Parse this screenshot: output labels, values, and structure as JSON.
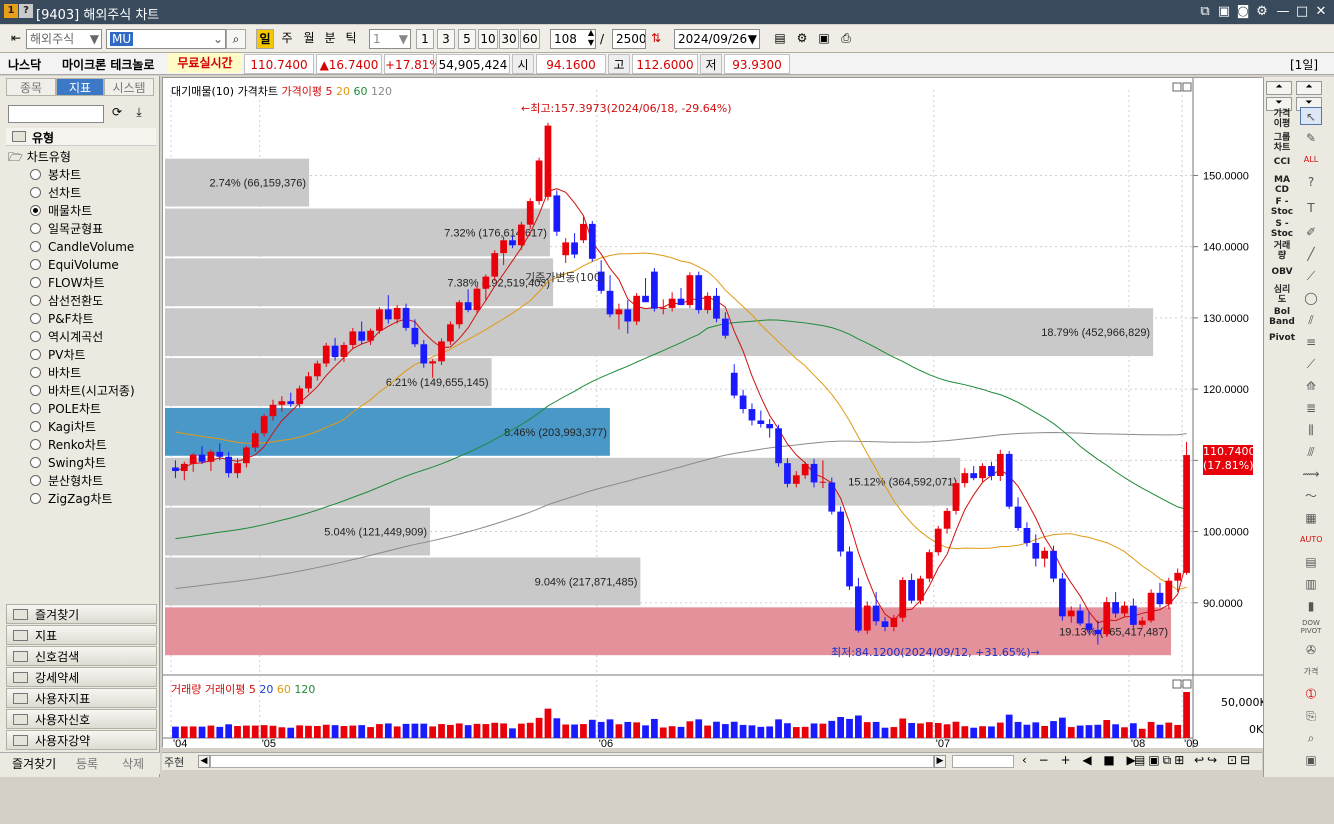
{
  "window": {
    "title": "[9403] 해외주식 차트",
    "icon1": "1",
    "icon2": "?"
  },
  "toolbar": {
    "market_select": "해외주식",
    "symbol": "MU",
    "periods": [
      "일",
      "주",
      "월",
      "분",
      "틱"
    ],
    "interval_value": "1",
    "interval_buttons": [
      "1",
      "3",
      "5",
      "10",
      "30",
      "60"
    ],
    "count_value": "108",
    "total_value": "2500",
    "slash": "/",
    "date": "2024/09/26"
  },
  "quote": {
    "exchange": "나스닥",
    "name": "마이크론 테크놀로",
    "realtime": "무료실시간",
    "price": "110.7400",
    "change": "▲16.7400",
    "change_pct": "+17.81%",
    "volume": "54,905,424",
    "open_label": "시",
    "open": "94.1600",
    "high_label": "고",
    "high": "112.6000",
    "low_label": "저",
    "low": "93.9300",
    "period": "[1일]"
  },
  "left_panel": {
    "tabs": [
      "종목",
      "지표",
      "시스템"
    ],
    "active_tab": "지표",
    "tree_root": "유형",
    "tree_group": "차트유형",
    "chart_types": [
      "봉차트",
      "선차트",
      "매물차트",
      "일목균형표",
      "CandleVolume",
      "EquiVolume",
      "FLOW차트",
      "삼선전환도",
      "P&F차트",
      "역시계곡선",
      "PV차트",
      "바차트",
      "바차트(시고저종)",
      "POLE차트",
      "Kagi차트",
      "Renko차트",
      "Swing차트",
      "분산형차트",
      "ZigZag차트"
    ],
    "selected_type": "매물차트",
    "bottom_buttons": [
      "즐겨찾기",
      "지표",
      "신호검색",
      "강세약세",
      "사용자지표",
      "사용자신호",
      "사용자강약"
    ],
    "footer_tabs": [
      "즐겨찾기",
      "등록",
      "삭제"
    ]
  },
  "chart": {
    "legend_items": [
      "대기매물(10)",
      "가격차트",
      "가격이평",
      "5",
      "20",
      "60",
      "120"
    ],
    "vol_legend_items": [
      "거래량",
      "거래이평",
      "5",
      "20",
      "60",
      "120"
    ],
    "max_label": "←최고:157.3973(2024/06/18, -29.64%)",
    "min_label": "최저:84.1200(2024/09/12, +31.65%)→",
    "base_label": "기준가변동(100)",
    "price_tag": "110.7400",
    "price_pct_tag": "(17.81%)",
    "vol_axis": [
      "50,000K",
      "0K"
    ],
    "bottom_label": "주현"
  },
  "chart_data": {
    "type": "candlestick",
    "y_axis": {
      "ticks": [
        "150.0000",
        "140.0000",
        "130.0000",
        "120.0000",
        "110.0000",
        "100.0000",
        "90.0000"
      ],
      "range": [
        80,
        162
      ]
    },
    "x_axis": {
      "ticks": [
        "'04",
        "'05",
        "'06",
        "'07",
        "'08",
        "'09"
      ]
    },
    "volume_profile": [
      {
        "label": "2.74% (66,159,376)",
        "range": [
          145.5,
          152.5
        ]
      },
      {
        "label": "7.32% (176,614,617)",
        "range": [
          138.5,
          145.5
        ]
      },
      {
        "label": "7.38% (192,519,403)",
        "range": [
          131.5,
          138.5
        ]
      },
      {
        "label": "18.79% (452,966,829)",
        "range": [
          124.5,
          131.5
        ]
      },
      {
        "label": "6.21% (149,655,145)",
        "range": [
          117.5,
          124.5
        ]
      },
      {
        "label": "8.46% (203,993,377)",
        "range": [
          110.5,
          117.5
        ]
      },
      {
        "label": "15.12% (364,592,071)",
        "range": [
          103.5,
          110.5
        ]
      },
      {
        "label": "5.04% (121,449,909)",
        "range": [
          96.5,
          103.5
        ]
      },
      {
        "label": "9.04% (217,871,485)",
        "range": [
          89.5,
          96.5
        ]
      },
      {
        "label": "19.13% (465,417,487)",
        "range": [
          82.5,
          89.5
        ]
      }
    ],
    "profile_pct": [
      2.74,
      7.32,
      7.38,
      18.79,
      6.21,
      8.46,
      15.12,
      5.04,
      9.04,
      19.13
    ],
    "candles": [
      [
        109,
        110,
        107.5,
        108.5
      ],
      [
        108.5,
        109.8,
        107.2,
        109.5
      ],
      [
        109.5,
        111,
        108.4,
        110.8
      ],
      [
        110.8,
        112,
        109.5,
        109.8
      ],
      [
        109.8,
        111.5,
        108.5,
        111.2
      ],
      [
        111.2,
        112.4,
        110,
        110.5
      ],
      [
        110.5,
        111.2,
        107.6,
        108.2
      ],
      [
        108.2,
        110.3,
        107.5,
        109.6
      ],
      [
        109.6,
        112,
        109,
        111.8
      ],
      [
        111.8,
        114.2,
        111.2,
        113.8
      ],
      [
        113.8,
        116.5,
        113.3,
        116.2
      ],
      [
        116.2,
        118.5,
        115.6,
        117.8
      ],
      [
        117.8,
        119,
        116.8,
        118.3
      ],
      [
        118.3,
        119.5,
        117.5,
        117.9
      ],
      [
        117.9,
        120.5,
        117.4,
        120.1
      ],
      [
        120.1,
        122.4,
        119.5,
        121.8
      ],
      [
        121.8,
        124,
        121.2,
        123.6
      ],
      [
        123.6,
        126.5,
        123.1,
        126.1
      ],
      [
        126.1,
        127.2,
        124,
        124.5
      ],
      [
        124.5,
        126.6,
        123.8,
        126.2
      ],
      [
        126.2,
        128.6,
        125.6,
        128.1
      ],
      [
        128.1,
        129.5,
        126.3,
        126.8
      ],
      [
        126.8,
        128.5,
        126.2,
        128.2
      ],
      [
        128.2,
        131.5,
        127.8,
        131.2
      ],
      [
        131.2,
        133.2,
        129.2,
        129.8
      ],
      [
        129.8,
        131.8,
        129.2,
        131.4
      ],
      [
        131.4,
        132,
        128.2,
        128.6
      ],
      [
        128.6,
        129.8,
        125.9,
        126.3
      ],
      [
        126.3,
        126.9,
        123,
        123.6
      ],
      [
        123.6,
        124.2,
        121.6,
        123.9
      ],
      [
        123.9,
        127.1,
        123.4,
        126.7
      ],
      [
        126.7,
        129.5,
        126.2,
        129.1
      ],
      [
        129.1,
        132.5,
        128.5,
        132.2
      ],
      [
        132.2,
        134,
        130.8,
        131.1
      ],
      [
        131.1,
        134.5,
        130.7,
        134.1
      ],
      [
        134.1,
        136.1,
        132.4,
        135.8
      ],
      [
        135.8,
        139.5,
        135.2,
        139.1
      ],
      [
        139.1,
        141.4,
        137.4,
        140.9
      ],
      [
        140.9,
        141.5,
        139.8,
        140.2
      ],
      [
        140.2,
        143.5,
        139.6,
        143.1
      ],
      [
        143.1,
        146.8,
        142.5,
        146.4
      ],
      [
        146.4,
        152.5,
        145.9,
        152.1
      ],
      [
        147,
        157.4,
        146.5,
        157
      ],
      [
        147.2,
        147.9,
        141.5,
        142.1
      ],
      [
        138.8,
        141.2,
        137.7,
        140.6
      ],
      [
        140.6,
        141.9,
        138.4,
        138.9
      ],
      [
        140.9,
        144.2,
        140.5,
        143.2
      ],
      [
        143.2,
        143.6,
        137.9,
        138.3
      ],
      [
        136.5,
        138.1,
        133.4,
        133.8
      ],
      [
        133.8,
        136,
        130.1,
        130.5
      ],
      [
        130.5,
        132,
        128.4,
        131.2
      ],
      [
        131.2,
        132.5,
        127.8,
        129.5
      ],
      [
        129.5,
        133.5,
        129,
        133.1
      ],
      [
        133.1,
        135.6,
        132.5,
        132.2
      ],
      [
        136.5,
        137,
        130.9,
        131.3
      ],
      [
        131.3,
        132.6,
        130.5,
        131.4
      ],
      [
        131.4,
        133.6,
        130.9,
        132.7
      ],
      [
        132.7,
        134.2,
        131.8,
        131.8
      ],
      [
        131.8,
        136.4,
        131.4,
        136
      ],
      [
        136,
        136.5,
        130.6,
        131.1
      ],
      [
        131.1,
        133.6,
        130.6,
        133.1
      ],
      [
        133.1,
        134.2,
        129.4,
        129.9
      ],
      [
        129.9,
        130.8,
        127.1,
        127.5
      ],
      [
        122.3,
        123.5,
        118.7,
        119.1
      ],
      [
        119.1,
        119.9,
        116.6,
        117.2
      ],
      [
        117.2,
        118,
        114.9,
        115.6
      ],
      [
        115.6,
        117,
        114.6,
        115.1
      ],
      [
        115.1,
        115.8,
        113.2,
        114.5
      ],
      [
        114.5,
        115,
        109.1,
        109.6
      ],
      [
        109.6,
        110.3,
        106.2,
        106.7
      ],
      [
        106.7,
        108.5,
        106.2,
        107.9
      ],
      [
        107.9,
        109.8,
        107.4,
        109.5
      ],
      [
        109.5,
        110.2,
        106.2,
        106.9
      ],
      [
        106.9,
        110,
        106.1,
        107
      ],
      [
        106.9,
        107.6,
        102.4,
        102.8
      ],
      [
        102.8,
        103.5,
        96.5,
        97.2
      ],
      [
        97.2,
        97.9,
        91.8,
        92.3
      ],
      [
        92.3,
        93.5,
        85.8,
        86.1
      ],
      [
        86.1,
        90.2,
        85.6,
        89.6
      ],
      [
        89.6,
        91.5,
        86.8,
        87.4
      ],
      [
        87.4,
        88,
        86,
        86.6
      ],
      [
        86.6,
        88.3,
        86,
        87.9
      ],
      [
        87.9,
        93.6,
        87.3,
        93.2
      ],
      [
        93.2,
        94.1,
        89.9,
        90.3
      ],
      [
        90.3,
        93.8,
        89.8,
        93.4
      ],
      [
        93.4,
        97.5,
        92.9,
        97.1
      ],
      [
        97.1,
        100.8,
        96.6,
        100.4
      ],
      [
        100.4,
        103.3,
        99.7,
        102.9
      ],
      [
        102.9,
        107.2,
        102.4,
        106.8
      ],
      [
        106.8,
        108.9,
        106.2,
        108.2
      ],
      [
        108.2,
        109.2,
        107.2,
        107.5
      ],
      [
        107.5,
        109.6,
        106.9,
        109.2
      ],
      [
        109.2,
        109.8,
        107.2,
        107.8
      ],
      [
        107.8,
        111.5,
        107.1,
        110.9
      ],
      [
        110.9,
        111.3,
        103.2,
        103.5
      ],
      [
        103.5,
        104.8,
        100.1,
        100.5
      ],
      [
        100.5,
        101.3,
        97.9,
        98.4
      ],
      [
        98.4,
        99.6,
        95.1,
        96.2
      ],
      [
        96.2,
        97.8,
        95,
        97.3
      ],
      [
        97.3,
        98,
        92.9,
        93.4
      ],
      [
        93.4,
        94.2,
        87.5,
        88.1
      ],
      [
        88.1,
        89.5,
        87.2,
        88.9
      ],
      [
        88.9,
        89.8,
        86.8,
        87.1
      ],
      [
        87.1,
        88.8,
        85.6,
        86.2
      ],
      [
        86.2,
        87.5,
        84.12,
        85.6
      ],
      [
        85.6,
        90.8,
        85.2,
        90.1
      ],
      [
        90.1,
        91.5,
        87.9,
        88.5
      ],
      [
        88.5,
        90.2,
        88,
        89.6
      ],
      [
        89.6,
        90.6,
        86.5,
        86.9
      ],
      [
        86.9,
        88,
        86.5,
        87.5
      ],
      [
        87.5,
        91.9,
        87.2,
        91.4
      ],
      [
        91.4,
        92.8,
        89.4,
        89.8
      ],
      [
        89.8,
        93.5,
        89.1,
        93.1
      ],
      [
        93.1,
        94.8,
        91.5,
        94.2
      ],
      [
        94.2,
        112.6,
        93.93,
        110.74
      ]
    ],
    "ma_color": {
      "5": "#d01010",
      "20": "#e09a10",
      "60": "#1e8a3a",
      "120": "#8a8a8a"
    },
    "colors": {
      "up": "#e8000b",
      "down": "#1a1aff",
      "profile": "#c9c9c9",
      "profile_current": "#4a98c8",
      "profile_low": "#e4919c"
    }
  }
}
